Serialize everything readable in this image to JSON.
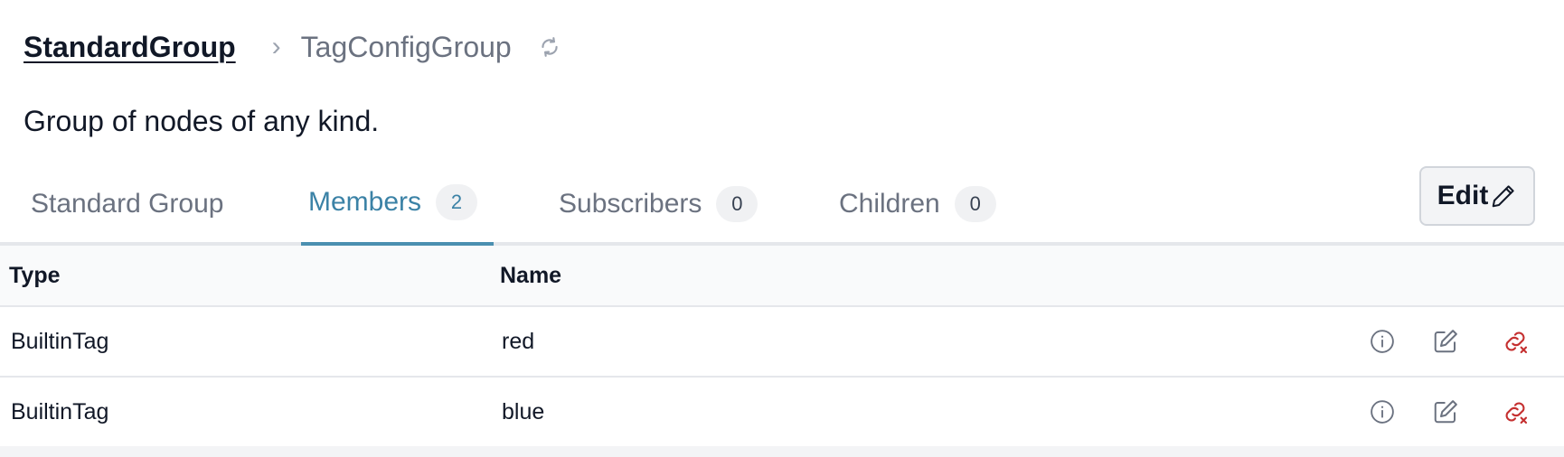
{
  "breadcrumb": {
    "parent": "StandardGroup",
    "separator": "›",
    "current": "TagConfigGroup"
  },
  "description": "Group of nodes of any kind.",
  "tabs": [
    {
      "label": "Standard Group",
      "count": null,
      "active": false
    },
    {
      "label": "Members",
      "count": "2",
      "active": true
    },
    {
      "label": "Subscribers",
      "count": "0",
      "active": false
    },
    {
      "label": "Children",
      "count": "0",
      "active": false
    }
  ],
  "edit_button": {
    "label": "Edit",
    "icon": "pencil-icon"
  },
  "table": {
    "headers": [
      "Type",
      "Name"
    ],
    "rows": [
      {
        "type": "BuiltinTag",
        "name": "red"
      },
      {
        "type": "BuiltinTag",
        "name": "blue"
      }
    ],
    "row_actions": [
      "info-icon",
      "edit-icon",
      "unlink-icon"
    ]
  },
  "colors": {
    "accent": "#3b82a6",
    "danger": "#c53030",
    "muted": "#6b7280"
  }
}
